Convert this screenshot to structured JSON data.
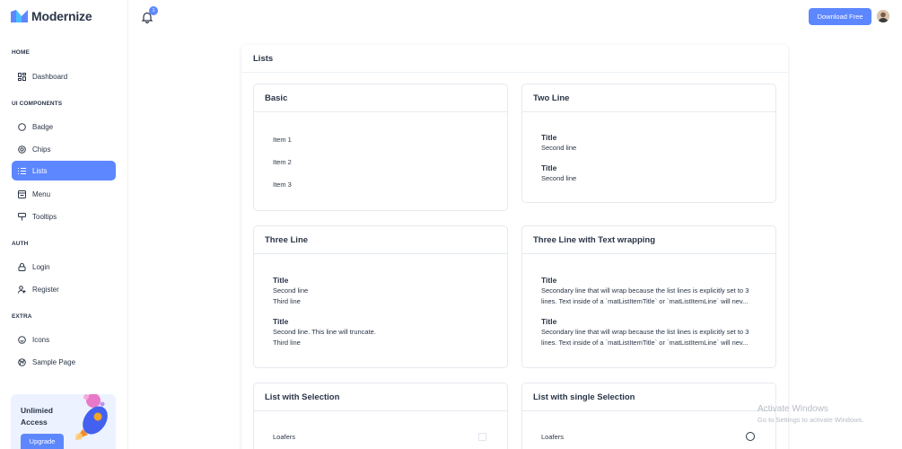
{
  "brand": {
    "name": "Modernize",
    "accent": "#5d87ff"
  },
  "header": {
    "notifications": "1",
    "download_label": "Download Free"
  },
  "sidebar": {
    "sections": [
      {
        "caption": "HOME",
        "items": [
          {
            "label": "Dashboard",
            "icon": "layout-dashboard-icon"
          }
        ]
      },
      {
        "caption": "UI COMPONENTS",
        "items": [
          {
            "label": "Badge",
            "icon": "circle-icon"
          },
          {
            "label": "Chips",
            "icon": "chips-icon"
          },
          {
            "label": "Lists",
            "icon": "list-icon",
            "active": true
          },
          {
            "label": "Menu",
            "icon": "menu-icon"
          },
          {
            "label": "Tooltips",
            "icon": "tooltip-icon"
          }
        ]
      },
      {
        "caption": "AUTH",
        "items": [
          {
            "label": "Login",
            "icon": "lock-icon"
          },
          {
            "label": "Register",
            "icon": "user-plus-icon"
          }
        ]
      },
      {
        "caption": "EXTRA",
        "items": [
          {
            "label": "Icons",
            "icon": "mood-smile-icon"
          },
          {
            "label": "Sample Page",
            "icon": "aperture-icon"
          }
        ]
      }
    ],
    "promo": {
      "title": "Unlimied Access",
      "button": "Upgrade"
    }
  },
  "page": {
    "title": "Lists",
    "basic": {
      "title": "Basic",
      "items": [
        "Item 1",
        "Item 2",
        "Item 3"
      ]
    },
    "two_line": {
      "title": "Two Line",
      "items": [
        {
          "title": "Title",
          "line": "Second line"
        },
        {
          "title": "Title",
          "line": "Second line"
        }
      ]
    },
    "three_line": {
      "title": "Three Line",
      "items": [
        {
          "title": "Title",
          "line2": "Second line",
          "line3": "Third line"
        },
        {
          "title": "Title",
          "line2": "Second line. This line will truncate.",
          "line3": "Third line"
        }
      ]
    },
    "three_line_wrap": {
      "title": "Three Line with Text wrapping",
      "items": [
        {
          "title": "Title",
          "text": "Secondary line that will wrap because the list lines is explicitly set to 3 lines. Text inside of a `matListItemTitle` or `matListItemLine` will nev..."
        },
        {
          "title": "Title",
          "text": "Secondary line that will wrap because the list lines is explicitly set to 3 lines. Text inside of a `matListItemTitle` or `matListItemLine` will nev..."
        }
      ]
    },
    "selection": {
      "title": "List with Selection",
      "first_item": "Loafers"
    },
    "single_selection": {
      "title": "List with single Selection",
      "first_item": "Loafers"
    }
  },
  "watermark": {
    "line1": "Activate Windows",
    "line2": "Go to Settings to activate Windows."
  }
}
